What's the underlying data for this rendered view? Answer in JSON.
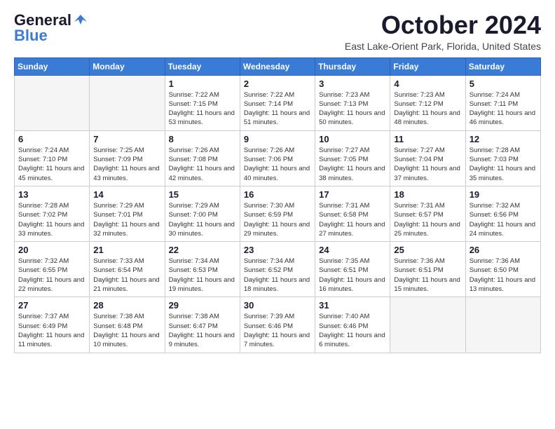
{
  "header": {
    "logo_general": "General",
    "logo_blue": "Blue",
    "month_title": "October 2024",
    "location": "East Lake-Orient Park, Florida, United States"
  },
  "weekdays": [
    "Sunday",
    "Monday",
    "Tuesday",
    "Wednesday",
    "Thursday",
    "Friday",
    "Saturday"
  ],
  "weeks": [
    [
      {
        "day": "",
        "empty": true
      },
      {
        "day": "",
        "empty": true
      },
      {
        "day": "1",
        "sunrise": "Sunrise: 7:22 AM",
        "sunset": "Sunset: 7:15 PM",
        "daylight": "Daylight: 11 hours and 53 minutes."
      },
      {
        "day": "2",
        "sunrise": "Sunrise: 7:22 AM",
        "sunset": "Sunset: 7:14 PM",
        "daylight": "Daylight: 11 hours and 51 minutes."
      },
      {
        "day": "3",
        "sunrise": "Sunrise: 7:23 AM",
        "sunset": "Sunset: 7:13 PM",
        "daylight": "Daylight: 11 hours and 50 minutes."
      },
      {
        "day": "4",
        "sunrise": "Sunrise: 7:23 AM",
        "sunset": "Sunset: 7:12 PM",
        "daylight": "Daylight: 11 hours and 48 minutes."
      },
      {
        "day": "5",
        "sunrise": "Sunrise: 7:24 AM",
        "sunset": "Sunset: 7:11 PM",
        "daylight": "Daylight: 11 hours and 46 minutes."
      }
    ],
    [
      {
        "day": "6",
        "sunrise": "Sunrise: 7:24 AM",
        "sunset": "Sunset: 7:10 PM",
        "daylight": "Daylight: 11 hours and 45 minutes."
      },
      {
        "day": "7",
        "sunrise": "Sunrise: 7:25 AM",
        "sunset": "Sunset: 7:09 PM",
        "daylight": "Daylight: 11 hours and 43 minutes."
      },
      {
        "day": "8",
        "sunrise": "Sunrise: 7:26 AM",
        "sunset": "Sunset: 7:08 PM",
        "daylight": "Daylight: 11 hours and 42 minutes."
      },
      {
        "day": "9",
        "sunrise": "Sunrise: 7:26 AM",
        "sunset": "Sunset: 7:06 PM",
        "daylight": "Daylight: 11 hours and 40 minutes."
      },
      {
        "day": "10",
        "sunrise": "Sunrise: 7:27 AM",
        "sunset": "Sunset: 7:05 PM",
        "daylight": "Daylight: 11 hours and 38 minutes."
      },
      {
        "day": "11",
        "sunrise": "Sunrise: 7:27 AM",
        "sunset": "Sunset: 7:04 PM",
        "daylight": "Daylight: 11 hours and 37 minutes."
      },
      {
        "day": "12",
        "sunrise": "Sunrise: 7:28 AM",
        "sunset": "Sunset: 7:03 PM",
        "daylight": "Daylight: 11 hours and 35 minutes."
      }
    ],
    [
      {
        "day": "13",
        "sunrise": "Sunrise: 7:28 AM",
        "sunset": "Sunset: 7:02 PM",
        "daylight": "Daylight: 11 hours and 33 minutes."
      },
      {
        "day": "14",
        "sunrise": "Sunrise: 7:29 AM",
        "sunset": "Sunset: 7:01 PM",
        "daylight": "Daylight: 11 hours and 32 minutes."
      },
      {
        "day": "15",
        "sunrise": "Sunrise: 7:29 AM",
        "sunset": "Sunset: 7:00 PM",
        "daylight": "Daylight: 11 hours and 30 minutes."
      },
      {
        "day": "16",
        "sunrise": "Sunrise: 7:30 AM",
        "sunset": "Sunset: 6:59 PM",
        "daylight": "Daylight: 11 hours and 29 minutes."
      },
      {
        "day": "17",
        "sunrise": "Sunrise: 7:31 AM",
        "sunset": "Sunset: 6:58 PM",
        "daylight": "Daylight: 11 hours and 27 minutes."
      },
      {
        "day": "18",
        "sunrise": "Sunrise: 7:31 AM",
        "sunset": "Sunset: 6:57 PM",
        "daylight": "Daylight: 11 hours and 25 minutes."
      },
      {
        "day": "19",
        "sunrise": "Sunrise: 7:32 AM",
        "sunset": "Sunset: 6:56 PM",
        "daylight": "Daylight: 11 hours and 24 minutes."
      }
    ],
    [
      {
        "day": "20",
        "sunrise": "Sunrise: 7:32 AM",
        "sunset": "Sunset: 6:55 PM",
        "daylight": "Daylight: 11 hours and 22 minutes."
      },
      {
        "day": "21",
        "sunrise": "Sunrise: 7:33 AM",
        "sunset": "Sunset: 6:54 PM",
        "daylight": "Daylight: 11 hours and 21 minutes."
      },
      {
        "day": "22",
        "sunrise": "Sunrise: 7:34 AM",
        "sunset": "Sunset: 6:53 PM",
        "daylight": "Daylight: 11 hours and 19 minutes."
      },
      {
        "day": "23",
        "sunrise": "Sunrise: 7:34 AM",
        "sunset": "Sunset: 6:52 PM",
        "daylight": "Daylight: 11 hours and 18 minutes."
      },
      {
        "day": "24",
        "sunrise": "Sunrise: 7:35 AM",
        "sunset": "Sunset: 6:51 PM",
        "daylight": "Daylight: 11 hours and 16 minutes."
      },
      {
        "day": "25",
        "sunrise": "Sunrise: 7:36 AM",
        "sunset": "Sunset: 6:51 PM",
        "daylight": "Daylight: 11 hours and 15 minutes."
      },
      {
        "day": "26",
        "sunrise": "Sunrise: 7:36 AM",
        "sunset": "Sunset: 6:50 PM",
        "daylight": "Daylight: 11 hours and 13 minutes."
      }
    ],
    [
      {
        "day": "27",
        "sunrise": "Sunrise: 7:37 AM",
        "sunset": "Sunset: 6:49 PM",
        "daylight": "Daylight: 11 hours and 11 minutes."
      },
      {
        "day": "28",
        "sunrise": "Sunrise: 7:38 AM",
        "sunset": "Sunset: 6:48 PM",
        "daylight": "Daylight: 11 hours and 10 minutes."
      },
      {
        "day": "29",
        "sunrise": "Sunrise: 7:38 AM",
        "sunset": "Sunset: 6:47 PM",
        "daylight": "Daylight: 11 hours and 9 minutes."
      },
      {
        "day": "30",
        "sunrise": "Sunrise: 7:39 AM",
        "sunset": "Sunset: 6:46 PM",
        "daylight": "Daylight: 11 hours and 7 minutes."
      },
      {
        "day": "31",
        "sunrise": "Sunrise: 7:40 AM",
        "sunset": "Sunset: 6:46 PM",
        "daylight": "Daylight: 11 hours and 6 minutes."
      },
      {
        "day": "",
        "empty": true
      },
      {
        "day": "",
        "empty": true
      }
    ]
  ]
}
